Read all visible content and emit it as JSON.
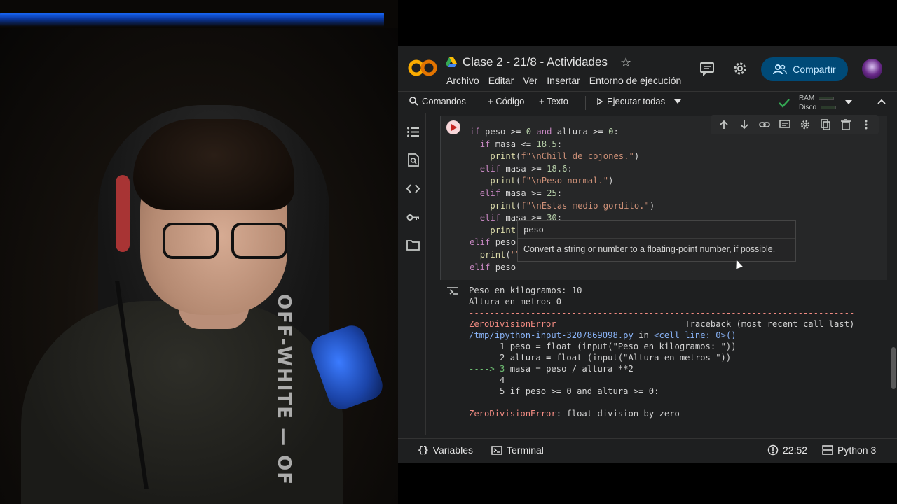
{
  "app": {
    "title": "Clase 2 - 21/8 - Actividades",
    "menu": [
      "Archivo",
      "Editar",
      "Ver",
      "Insertar",
      "Entorno de ejecución"
    ],
    "share_label": "Compartir"
  },
  "toolbar": {
    "commands_label": "Comandos",
    "code_label": "+ Código",
    "text_label": "+ Texto",
    "run_all_label": "Ejecutar todas",
    "ram_label": "RAM",
    "disk_label": "Disco"
  },
  "code_lines": [
    "if peso >= 0 and altura >= 0:",
    "  if masa <= 18.5:",
    "    print(f\"\\nChill de cojones.\")",
    "  elif masa >= 18.6:",
    "    print(f\"\\nPeso normal.\")",
    "  elif masa >= 25:",
    "    print(f\"\\nEstas medio gordito.\")",
    "  elif masa >= 30:",
    "    print(",
    "elif peso",
    "  print(\"\\",
    "elif peso"
  ],
  "tooltip": {
    "signature": "peso",
    "doc": "Convert a string or number to a floating-point number, if possible."
  },
  "output": {
    "line1": "Peso en kilogramos: 10",
    "line2": "Altura en metros 0",
    "dashes": "---------------------------------------------------------------------------",
    "error_name": "ZeroDivisionError",
    "traceback_header": "Traceback (most recent call last)",
    "file_link": "/tmp/ipython-input-3207869098.py",
    "in_text": " in ",
    "cell_ref": "<cell line: 0>()",
    "tb1": "      1 peso = float (input(\"Peso en kilogramos: \"))",
    "tb2": "      2 altura = float (input(\"Altura en metros \"))",
    "tb3_arrow": "----> 3",
    "tb3": " masa = peso / altura **2",
    "tb4": "      4",
    "tb5": "      5 if peso >= 0 and altura >= 0:",
    "final_error": "ZeroDivisionError",
    "final_msg": ": float division by zero"
  },
  "status": {
    "variables_label": "Variables",
    "terminal_label": "Terminal",
    "time": "22:52",
    "runtime": "Python 3"
  },
  "webcam": {
    "shirt_text": "OFF-WHITE — OF"
  },
  "colors": {
    "accent_share": "#004a77",
    "error": "#f28b82",
    "link": "#8ab4f8",
    "keyword": "#c586c0"
  }
}
